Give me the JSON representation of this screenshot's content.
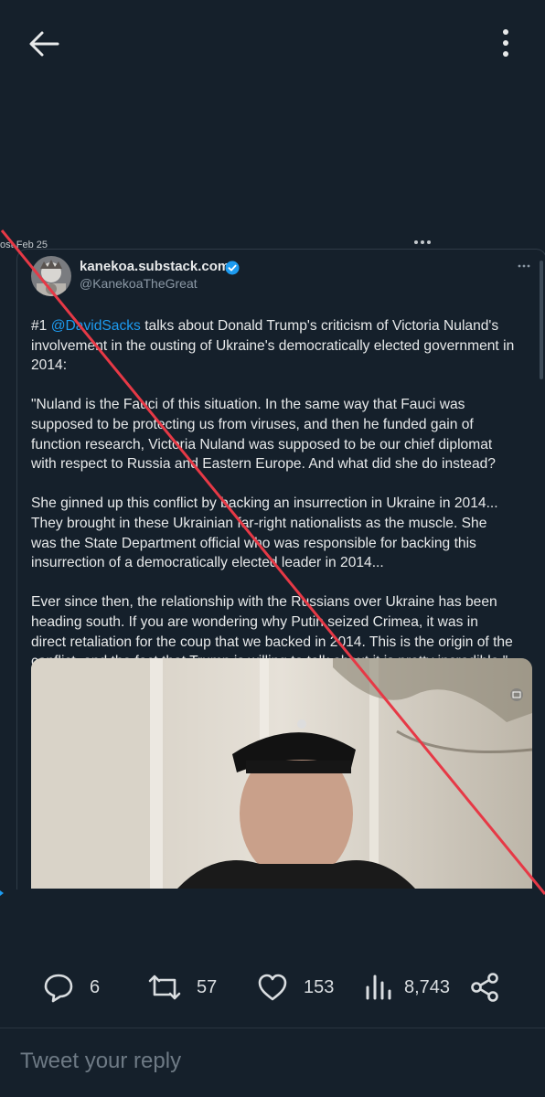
{
  "embed": {
    "date": "ost Feb 25",
    "author": {
      "name": "kanekoa.substack.com",
      "handle": "@KanekoaTheGreat"
    },
    "body": {
      "p1_prefix": "#1 ",
      "p1_mention": "@DavidSacks",
      "p1_rest": " talks about Donald Trump's criticism of Victoria Nuland's involvement in the ousting of Ukraine's democratically elected government in 2014:",
      "p2": "\"Nuland is the Fauci of this situation. In the same way that Fauci was supposed to be protecting us from viruses, and then he funded gain of function research, Victoria Nuland was supposed to be our chief diplomat with respect to Russia and Eastern Europe. And what did she do instead?",
      "p3": "She ginned up this conflict by backing an insurrection in Ukraine in 2014... They brought in these Ukrainian far-right nationalists as the muscle. She was the State Department official who was responsible for backing this insurrection of a democratically elected leader in 2014...",
      "p4": "Ever since then, the relationship with the Russians over Ukraine has been heading south. If you are wondering why Putin seized Crimea, it was in direct retaliation for the coup that we backed in 2014. This is the origin of the conflict, and the fact that Trump is willing to talk about it is pretty incredible.\""
    }
  },
  "actions": {
    "replies": "6",
    "reposts": "57",
    "likes": "153",
    "views": "8,743"
  },
  "reply": {
    "placeholder": "Tweet your reply"
  },
  "colors": {
    "background": "#15202b",
    "accent": "#1d9bf0",
    "strike": "#e63946"
  }
}
